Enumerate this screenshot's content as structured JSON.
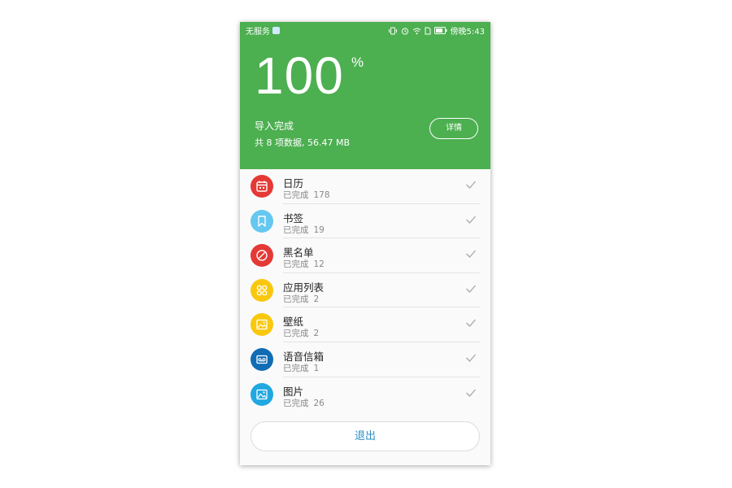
{
  "status_bar": {
    "carrier": "无服务",
    "time": "傍晚5:43"
  },
  "header": {
    "percent": "100",
    "percent_sign": "%",
    "title": "导入完成",
    "summary": "共 8 项数据, 56.47 MB",
    "detail_button": "详情",
    "progress_fraction": 1.0,
    "bg_color": "#4caf50"
  },
  "items": [
    {
      "name": "日历",
      "status": "已完成",
      "count": "178",
      "icon": "calendar-icon",
      "color": "#e53935"
    },
    {
      "name": "书签",
      "status": "已完成",
      "count": "19",
      "icon": "bookmark-icon",
      "color": "#64c8f0"
    },
    {
      "name": "黑名单",
      "status": "已完成",
      "count": "12",
      "icon": "block-icon",
      "color": "#e53935"
    },
    {
      "name": "应用列表",
      "status": "已完成",
      "count": "2",
      "icon": "apps-grid-icon",
      "color": "#f9c80e"
    },
    {
      "name": "壁纸",
      "status": "已完成",
      "count": "2",
      "icon": "wallpaper-icon",
      "color": "#f9c80e"
    },
    {
      "name": "语音信箱",
      "status": "已完成",
      "count": "1",
      "icon": "voicemail-icon",
      "color": "#0f6cb5"
    },
    {
      "name": "图片",
      "status": "已完成",
      "count": "26",
      "icon": "image-icon",
      "color": "#20a8e0"
    }
  ],
  "exit_button": "退出",
  "accent_color": "#2a8fc4"
}
